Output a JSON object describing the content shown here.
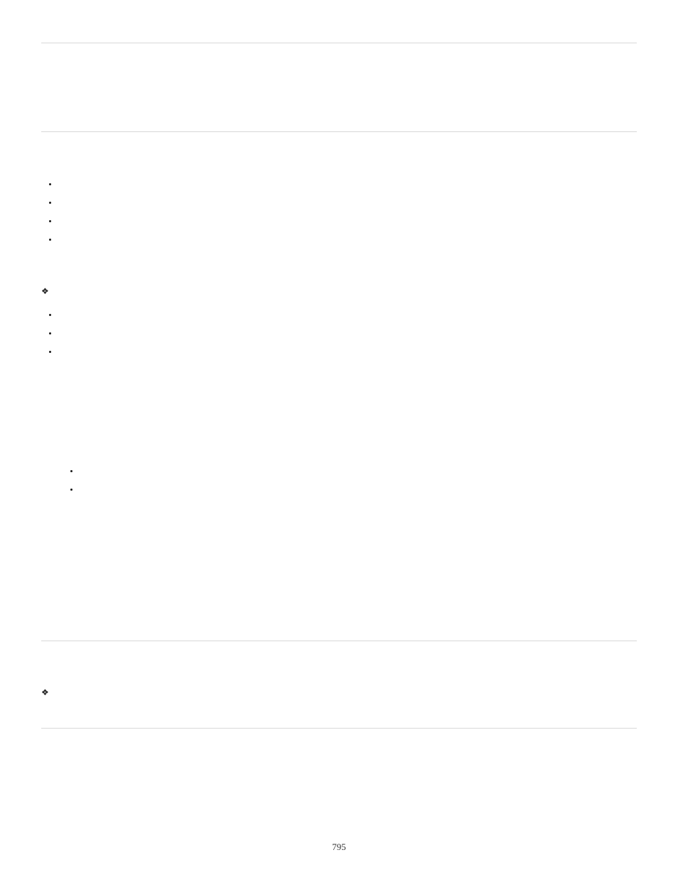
{
  "page_number": "795",
  "sections": {
    "s1": {
      "intro": "",
      "bullets": [
        "",
        "",
        "",
        ""
      ]
    },
    "s2": {
      "diamond": "",
      "bullets": [
        "",
        "",
        ""
      ]
    },
    "s3": {
      "sub_bullets": [
        "",
        ""
      ]
    },
    "s4": {
      "diamond": ""
    }
  }
}
